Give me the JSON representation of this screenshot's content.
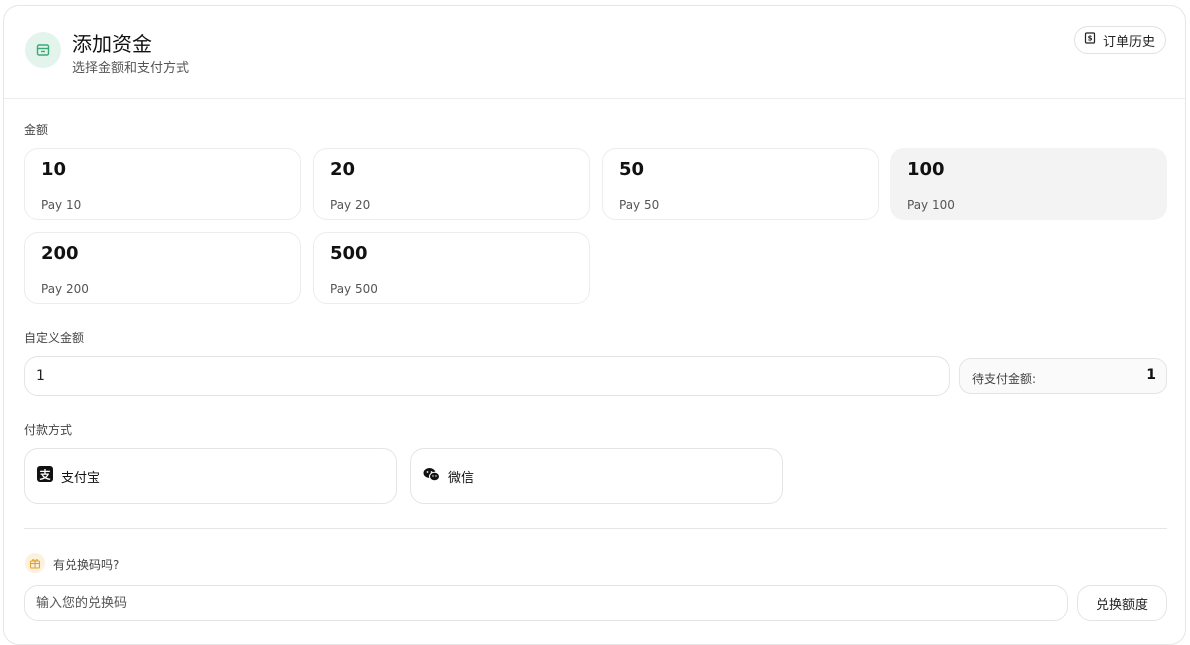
{
  "header": {
    "title": "添加资金",
    "subtitle": "选择金额和支付方式",
    "icon": "wallet-icon",
    "history_label": "订单历史",
    "history_icon": "receipt-icon"
  },
  "amount_section": {
    "label": "金额",
    "options": [
      {
        "value": "10",
        "sub": "Pay 10",
        "selected": false
      },
      {
        "value": "20",
        "sub": "Pay 20",
        "selected": false
      },
      {
        "value": "50",
        "sub": "Pay 50",
        "selected": false
      },
      {
        "value": "100",
        "sub": "Pay 100",
        "selected": true
      },
      {
        "value": "200",
        "sub": "Pay 200",
        "selected": false
      },
      {
        "value": "500",
        "sub": "Pay 500",
        "selected": false
      }
    ]
  },
  "custom_amount": {
    "label": "自定义金额",
    "value": "1",
    "pending_label": "待支付金额:",
    "pending_value": "1"
  },
  "payment": {
    "label": "付款方式",
    "methods": [
      {
        "label": "支付宝",
        "icon": "alipay-icon"
      },
      {
        "label": "微信",
        "icon": "wechat-icon"
      }
    ]
  },
  "redeem": {
    "question": "有兑换码吗?",
    "icon": "gift-icon",
    "placeholder": "输入您的兑换码",
    "button_label": "兑换额度"
  },
  "colors": {
    "accent_green": "#3aa876",
    "selected_bg": "#f3f3f3",
    "gift_accent": "#e0a33a"
  }
}
